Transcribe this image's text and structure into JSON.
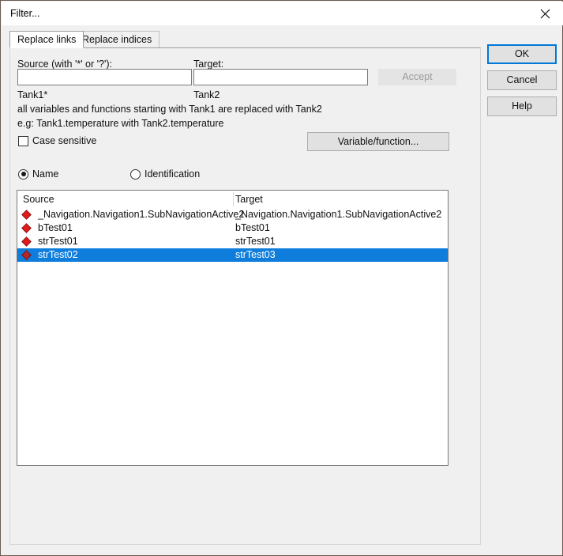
{
  "window": {
    "title": "Filter...",
    "close_icon": "close-icon"
  },
  "tabs": [
    {
      "label": "Replace links",
      "active": true
    },
    {
      "label": "Replace indices",
      "active": false
    }
  ],
  "form": {
    "source_label": "Source (with '*' or '?'):",
    "target_label": "Target:",
    "source_value": "",
    "target_value": "",
    "source_placeholder": "",
    "target_placeholder": "",
    "accept_label": "Accept",
    "accept_enabled": false,
    "example_source": "Tank1*",
    "example_target": "Tank2",
    "example_line1": "all variables and functions starting with Tank1 are replaced with Tank2",
    "example_line2": "e.g: Tank1.temperature with Tank2.temperature",
    "case_sensitive_label": "Case sensitive",
    "case_sensitive_checked": false,
    "variable_function_label": "Variable/function..."
  },
  "mode": {
    "name_label": "Name",
    "identification_label": "Identification",
    "selected": "Name"
  },
  "list": {
    "columns": [
      "Source",
      "Target"
    ],
    "row_icon": "red-diamond-icon",
    "rows": [
      {
        "source": "_Navigation.Navigation1.SubNavigationActive2",
        "target": "_Navigation.Navigation1.SubNavigationActive2",
        "selected": false
      },
      {
        "source": "bTest01",
        "target": "bTest01",
        "selected": false
      },
      {
        "source": "strTest01",
        "target": "strTest01",
        "selected": false
      },
      {
        "source": "strTest02",
        "target": "strTest03",
        "selected": true
      }
    ]
  },
  "actions": {
    "ok_label": "OK",
    "cancel_label": "Cancel",
    "help_label": "Help"
  },
  "colors": {
    "selection": "#0f7ddc",
    "focus_border": "#0078d7",
    "diamond": "#e01b1b",
    "window_bg": "#f0f0f0"
  }
}
